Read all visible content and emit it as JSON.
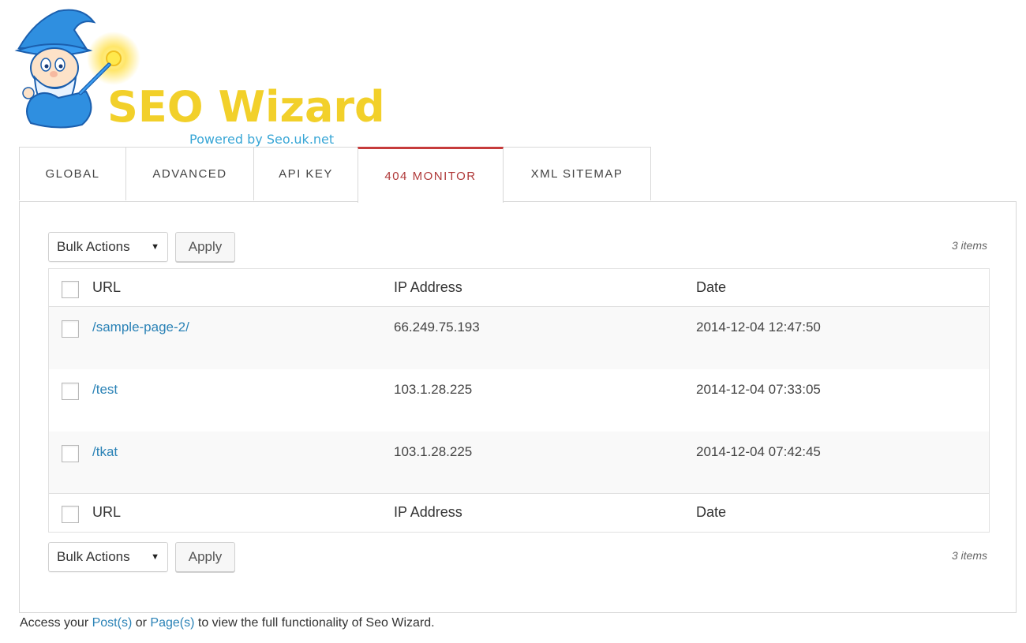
{
  "logo": {
    "title": "SEO Wizard",
    "subtitle": "Powered by Seo.uk.net",
    "icon": "wizard-mascot-icon",
    "colors": {
      "title": "#f2d02a",
      "subtitle": "#38a6d6",
      "hat": "#2f8fe0"
    }
  },
  "tabs": [
    {
      "label": "GLOBAL",
      "active": false
    },
    {
      "label": "ADVANCED",
      "active": false
    },
    {
      "label": "API KEY",
      "active": false
    },
    {
      "label": "404 MONITOR",
      "active": true
    },
    {
      "label": "XML SITEMAP",
      "active": false
    }
  ],
  "toolbar": {
    "bulk_actions": "Bulk Actions",
    "apply": "Apply",
    "item_count": "3 items"
  },
  "table": {
    "columns": [
      "URL",
      "IP Address",
      "Date"
    ],
    "rows": [
      {
        "url": "/sample-page-2/",
        "ip": "66.249.75.193",
        "date": "2014-12-04 12:47:50"
      },
      {
        "url": "/test",
        "ip": "103.1.28.225",
        "date": "2014-12-04 07:33:05"
      },
      {
        "url": "/tkat",
        "ip": "103.1.28.225",
        "date": "2014-12-04 07:42:45"
      }
    ]
  },
  "footer": {
    "prefix": "Access your ",
    "link_posts": "Post(s)",
    "middle": " or ",
    "link_pages": "Page(s)",
    "suffix": " to view the full functionality of Seo Wizard."
  },
  "colors": {
    "accent": "#c63b3b",
    "link": "#2a82b6"
  }
}
